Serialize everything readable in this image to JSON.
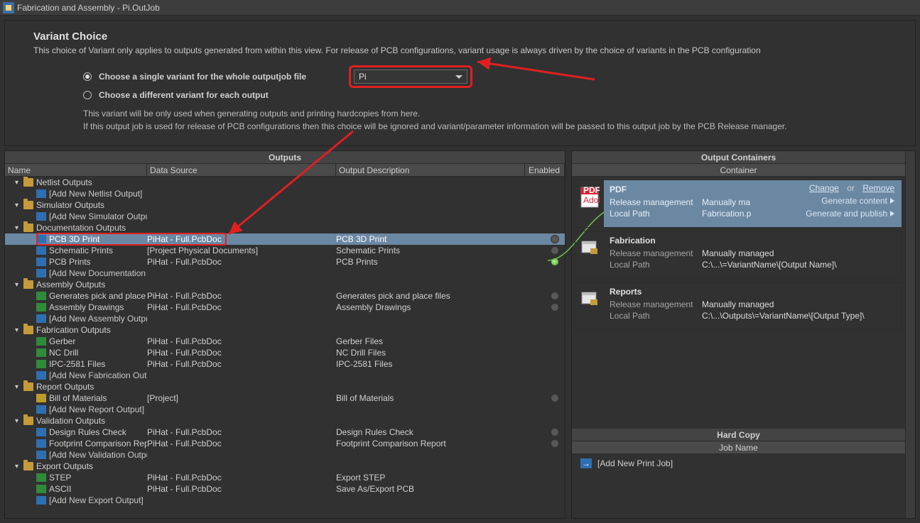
{
  "window": {
    "title": "Fabrication and Assembly - Pi.OutJob"
  },
  "variant": {
    "heading": "Variant Choice",
    "description": "This choice of Variant only applies to outputs generated from within this view. For release of PCB configurations, variant usage is always driven by the choice of variants in the PCB configuration",
    "radio_single": "Choose a single variant for the whole outputjob file",
    "radio_each": "Choose a different variant for each output",
    "selected_variant": "Pi",
    "note1": "This variant will be only used when generating outputs and printing hardcopies from here.",
    "note2": "If this output job is used for release of PCB configurations then this choice will be ignored and variant/parameter information will be passed to this output job by the PCB Release manager."
  },
  "outputs": {
    "title": "Outputs",
    "columns": {
      "name": "Name",
      "data_source": "Data Source",
      "description": "Output Description",
      "enabled": "Enabled"
    },
    "groups": [
      {
        "label": "Netlist Outputs",
        "add": "[Add New Netlist Output]",
        "rows": []
      },
      {
        "label": "Simulator Outputs",
        "add": "[Add New Simulator Output]",
        "rows": []
      },
      {
        "label": "Documentation Outputs",
        "add": "[Add New Documentation Output]",
        "rows": [
          {
            "icon": "blue",
            "name": "PCB 3D Print",
            "ds": "PiHat - Full.PcbDoc",
            "desc": "PCB 3D Print",
            "sel": true,
            "highlight": true,
            "dot": "off"
          },
          {
            "icon": "blue",
            "name": "Schematic Prints",
            "ds": "[Project Physical Documents]",
            "desc": "Schematic Prints",
            "dot": "off"
          },
          {
            "icon": "blue",
            "name": "PCB Prints",
            "ds": "PiHat - Full.PcbDoc",
            "desc": "PCB Prints",
            "dot": "green"
          }
        ]
      },
      {
        "label": "Assembly Outputs",
        "add": "[Add New Assembly Output]",
        "rows": [
          {
            "icon": "green",
            "name": "Generates pick and place files",
            "ds": "PiHat - Full.PcbDoc",
            "desc": "Generates pick and place files",
            "dot": "off"
          },
          {
            "icon": "green",
            "name": "Assembly Drawings",
            "ds": "PiHat - Full.PcbDoc",
            "desc": "Assembly Drawings",
            "dot": "off"
          }
        ]
      },
      {
        "label": "Fabrication Outputs",
        "add": "[Add New Fabrication Output]",
        "rows": [
          {
            "icon": "green",
            "name": "Gerber",
            "ds": "PiHat - Full.PcbDoc",
            "desc": "Gerber Files"
          },
          {
            "icon": "green",
            "name": "NC Drill",
            "ds": "PiHat - Full.PcbDoc",
            "desc": "NC Drill Files"
          },
          {
            "icon": "green",
            "name": "IPC-2581 Files",
            "ds": "PiHat - Full.PcbDoc",
            "desc": "IPC-2581 Files"
          }
        ]
      },
      {
        "label": "Report Outputs",
        "add": "[Add New Report Output]",
        "rows": [
          {
            "icon": "yellow",
            "name": "Bill of Materials",
            "ds": "[Project]",
            "desc": "Bill of Materials",
            "dot": "off"
          }
        ]
      },
      {
        "label": "Validation Outputs",
        "add": "[Add New Validation Output]",
        "rows": [
          {
            "icon": "blue",
            "name": "Design Rules Check",
            "ds": "PiHat - Full.PcbDoc",
            "desc": "Design Rules Check",
            "dot": "off"
          },
          {
            "icon": "blue",
            "name": "Footprint Comparison Report",
            "ds": "PiHat - Full.PcbDoc",
            "desc": "Footprint Comparison Report",
            "dot": "off"
          }
        ]
      },
      {
        "label": "Export Outputs",
        "add": "[Add New Export Output]",
        "rows": [
          {
            "icon": "green",
            "name": "STEP",
            "ds": "PiHat - Full.PcbDoc",
            "desc": "Export STEP"
          },
          {
            "icon": "green",
            "name": "ASCII",
            "ds": "PiHat - Full.PcbDoc",
            "desc": "Save As/Export PCB"
          }
        ]
      }
    ]
  },
  "containers": {
    "title": "Output Containers",
    "sub": "Container",
    "cards": [
      {
        "kind": "pdf",
        "title": "PDF",
        "rm_label": "Release management",
        "rm_value": "Manually managed",
        "lp_label": "Local Path",
        "lp_value": "Fabrication.pdf",
        "links": {
          "change": "Change",
          "or": "or",
          "remove": "Remove",
          "gen_content": "Generate content",
          "gen_publish": "Generate and publish"
        }
      },
      {
        "kind": "folder",
        "title": "Fabrication",
        "rm_label": "Release management",
        "rm_value": "Manually managed",
        "lp_label": "Local Path",
        "lp_value": "C:\\...\\=VariantName\\[Output Name]\\"
      },
      {
        "kind": "folder",
        "title": "Reports",
        "rm_label": "Release management",
        "rm_value": "Manually managed",
        "lp_label": "Local Path",
        "lp_value": "C:\\...\\Outputs\\=VariantName\\[Output Type]\\"
      }
    ],
    "hardcopy": {
      "title": "Hard Copy",
      "sub": "Job Name",
      "add": "[Add New Print Job]"
    }
  }
}
